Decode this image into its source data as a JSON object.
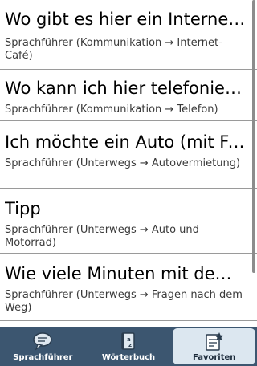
{
  "entries": [
    {
      "phrase": "Wo gibt es hier ein Internet-Café?",
      "source": "Sprachführer (Kommunikation → Internet-Café)"
    },
    {
      "phrase": "Wo kann ich hier telefonieren?",
      "source": "Sprachführer (Kommunikation → Telefon)"
    },
    {
      "phrase": "Ich möchte ein Auto (mit Fahrer) mieten.",
      "source": "Sprachführer (Unterwegs → Autovermietung)"
    },
    {
      "phrase": "Tipp",
      "source": "Sprachführer (Unterwegs → Auto und Motorrad)"
    },
    {
      "phrase": "Wie viele Minuten mit dem Bus?",
      "source": "Sprachführer (Unterwegs → Fragen nach dem Weg)"
    }
  ],
  "tabs": [
    {
      "label": "Sprachführer",
      "icon": "speech-bubble-icon"
    },
    {
      "label": "Wörterbuch",
      "icon": "dictionary-icon"
    },
    {
      "label": "Favoriten",
      "icon": "favorites-icon",
      "active": true
    }
  ]
}
